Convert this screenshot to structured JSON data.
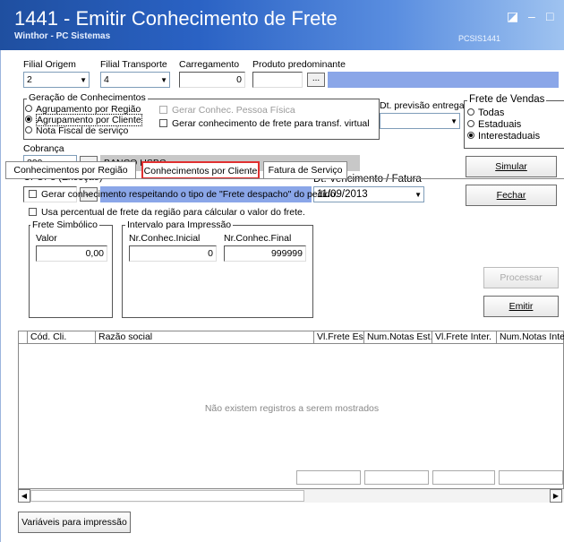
{
  "window": {
    "title": "1441 - Emitir Conhecimento de Frete",
    "subtitle": "Winthor - PC Sistemas",
    "code": "PCSIS1441",
    "btn_restore": "◪",
    "btn_min": "–",
    "btn_max": "□",
    "btn_close": "✕"
  },
  "top_fields": {
    "filial_origem_label": "Filial Origem",
    "filial_origem_value": "2",
    "filial_transporte_label": "Filial Transporte",
    "filial_transporte_value": "4",
    "carregamento_label": "Carregamento",
    "carregamento_value": "0",
    "produto_label": "Produto predominante",
    "produto_value": "",
    "produto_btn": "..."
  },
  "geracao": {
    "title": "Geração de Conhecimentos",
    "options": [
      {
        "label": "Agrupamento por Região",
        "selected": false
      },
      {
        "label": "Agrupamento por Cliente",
        "selected": true
      },
      {
        "label": "Nota Fiscal de serviço",
        "selected": false
      }
    ],
    "chk_pessoa_fisica": "Gerar Conhec. Pessoa Física",
    "chk_transf_virtual": "Gerar conhecimento de frete para transf. virtual"
  },
  "dt_previsao": {
    "label": "Dt. previsão entrega",
    "value": ""
  },
  "frete_vendas": {
    "title": "Frete de Vendas",
    "options": [
      {
        "label": "Todas",
        "selected": false
      },
      {
        "label": "Estaduais",
        "selected": false
      },
      {
        "label": "Interestaduais",
        "selected": true
      }
    ]
  },
  "cobranca": {
    "label": "Cobrança",
    "code": "399",
    "btn": "...",
    "name": "BANCO HSBC"
  },
  "cfops": {
    "label": "CFOPs  (Exceção)",
    "value": "",
    "btn": "..."
  },
  "vencimento": {
    "label": "Dt. Vencimento / Fatura",
    "value": "11/09/2013"
  },
  "buttons": {
    "simular": "Simular",
    "fechar": "Fechar",
    "processar": "Processar",
    "emitir": "Emitir",
    "variaveis": "Variáveis para impressão"
  },
  "tabs": [
    {
      "label": "Conhecimentos por Região",
      "active": false
    },
    {
      "label": "Conhecimentos por Cliente",
      "active": true
    },
    {
      "label": "Fatura de Serviço",
      "active": false
    }
  ],
  "tab_content": {
    "chk_frete_despacho": "Gerar conhecimento respeitando o tipo de \"Frete despacho\" do pedido.",
    "chk_percentual": "Usa percentual de frete da região para cálcular o valor do frete.",
    "frete_simbolico_title": "Frete Simbólico",
    "valor_label": "Valor",
    "valor_value": "0,00",
    "intervalo_title": "Intervalo para Impressão",
    "nr_inicial_label": "Nr.Conhec.Inicial",
    "nr_inicial_value": "0",
    "nr_final_label": "Nr.Conhec.Final",
    "nr_final_value": "999999"
  },
  "grid": {
    "columns": [
      "Cód. Cli.",
      "Razão social",
      "Vl.Frete Est.",
      "Num.Notas Est.",
      "Vl.Frete Inter.",
      "Num.Notas Inter."
    ],
    "empty_message": "Não existem registros a serem mostrados"
  },
  "colors": {
    "title_gradient_start": "#1f4fa0",
    "field_blue": "#8aa6e8",
    "field_grey": "#c8c8c8",
    "active_tab_border": "#e03030"
  }
}
